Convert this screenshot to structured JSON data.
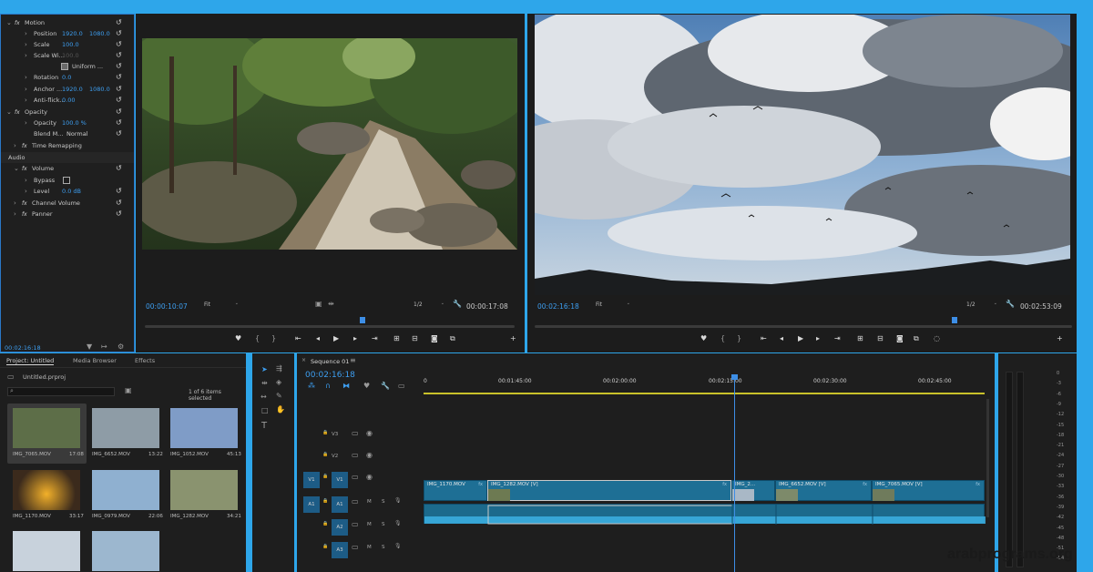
{
  "effect_controls": {
    "rows": [
      {
        "name": "Motion",
        "values": []
      },
      {
        "name": "Position",
        "values": [
          "1920.0",
          "1080.0"
        ]
      },
      {
        "name": "Scale",
        "values": [
          "100.0"
        ]
      },
      {
        "name": "Scale Wi...",
        "values": [
          "100.0"
        ]
      },
      {
        "name": "Uniform ...",
        "values": []
      },
      {
        "name": "Rotation",
        "values": [
          "0.0"
        ]
      },
      {
        "name": "Anchor ...",
        "values": [
          "1920.0",
          "1080.0"
        ]
      },
      {
        "name": "Anti-flick...",
        "values": [
          "0.00"
        ]
      },
      {
        "name": "Opacity",
        "values": []
      },
      {
        "name": "Opacity",
        "values": [
          "100.0 %"
        ]
      },
      {
        "name": "Blend M...",
        "values": [
          "Normal"
        ]
      },
      {
        "name": "Time Remapping",
        "values": []
      },
      {
        "name": "Audio",
        "values": []
      },
      {
        "name": "Volume",
        "values": []
      },
      {
        "name": "Bypass",
        "values": []
      },
      {
        "name": "Level",
        "values": [
          "0.0 dB"
        ]
      },
      {
        "name": "Channel Volume",
        "values": []
      },
      {
        "name": "Panner",
        "values": []
      }
    ],
    "timecode": "00:02:16:18"
  },
  "source_monitor": {
    "timecode": "00:00:10:07",
    "fit": "Fit",
    "resolution": "1/2",
    "duration": "00:00:17:08"
  },
  "program_monitor": {
    "timecode": "00:02:16:18",
    "fit": "Fit",
    "resolution": "1/2",
    "duration": "00:02:53:09"
  },
  "project": {
    "tabs": [
      "Project: Untitled",
      "Media Browser",
      "Effects"
    ],
    "file": "Untitled.prproj",
    "count": "1 of 6 items selected",
    "items": [
      {
        "name": "IMG_7065.MOV",
        "dur": "17:08"
      },
      {
        "name": "IMG_6652.MOV",
        "dur": "13:22"
      },
      {
        "name": "IMG_1052.MOV",
        "dur": "45:13"
      },
      {
        "name": "IMG_1170.MOV",
        "dur": "33:17"
      },
      {
        "name": "IMG_0979.MOV",
        "dur": "22:06"
      },
      {
        "name": "IMG_1282.MOV",
        "dur": "34:21"
      }
    ]
  },
  "sequence": {
    "name": "Sequence 01",
    "timecode": "00:02:16:18",
    "ruler": [
      "0",
      "00:01:45:00",
      "00:02:00:00",
      "00:02:15:00",
      "00:02:30:00",
      "00:02:45:00"
    ],
    "video_tracks": [
      "V3",
      "V2",
      "V1"
    ],
    "audio_tracks": [
      "A1",
      "A2",
      "A3"
    ],
    "track_btn": {
      "v1": "V1",
      "a1": "A1"
    },
    "track_flags": {
      "m": "M",
      "s": "S"
    },
    "clips": [
      "IMG_1170.MOV",
      "IMG_1282.MOV [V]",
      "IMG_2...",
      "IMG_6652.MOV [V]",
      "IMG_7065.MOV [V]"
    ]
  },
  "meter": {
    "labels": [
      "0",
      "-3",
      "-6",
      "-9",
      "-12",
      "-15",
      "-18",
      "-21",
      "-24",
      "-27",
      "-30",
      "-33",
      "-36",
      "-39",
      "-42",
      "-45",
      "-48",
      "-51",
      "-54"
    ]
  },
  "watermark": "arabprograms.org",
  "icons": [
    "stopwatch-icon",
    "wrench-icon",
    "play-icon",
    "step-back-icon",
    "step-forward-icon",
    "lock-icon",
    "eye-icon",
    "mic-icon",
    "selection-tool-icon",
    "razor-icon",
    "hand-icon",
    "type-icon",
    "search-icon",
    "plus-icon",
    "filter-icon",
    "film-icon"
  ]
}
